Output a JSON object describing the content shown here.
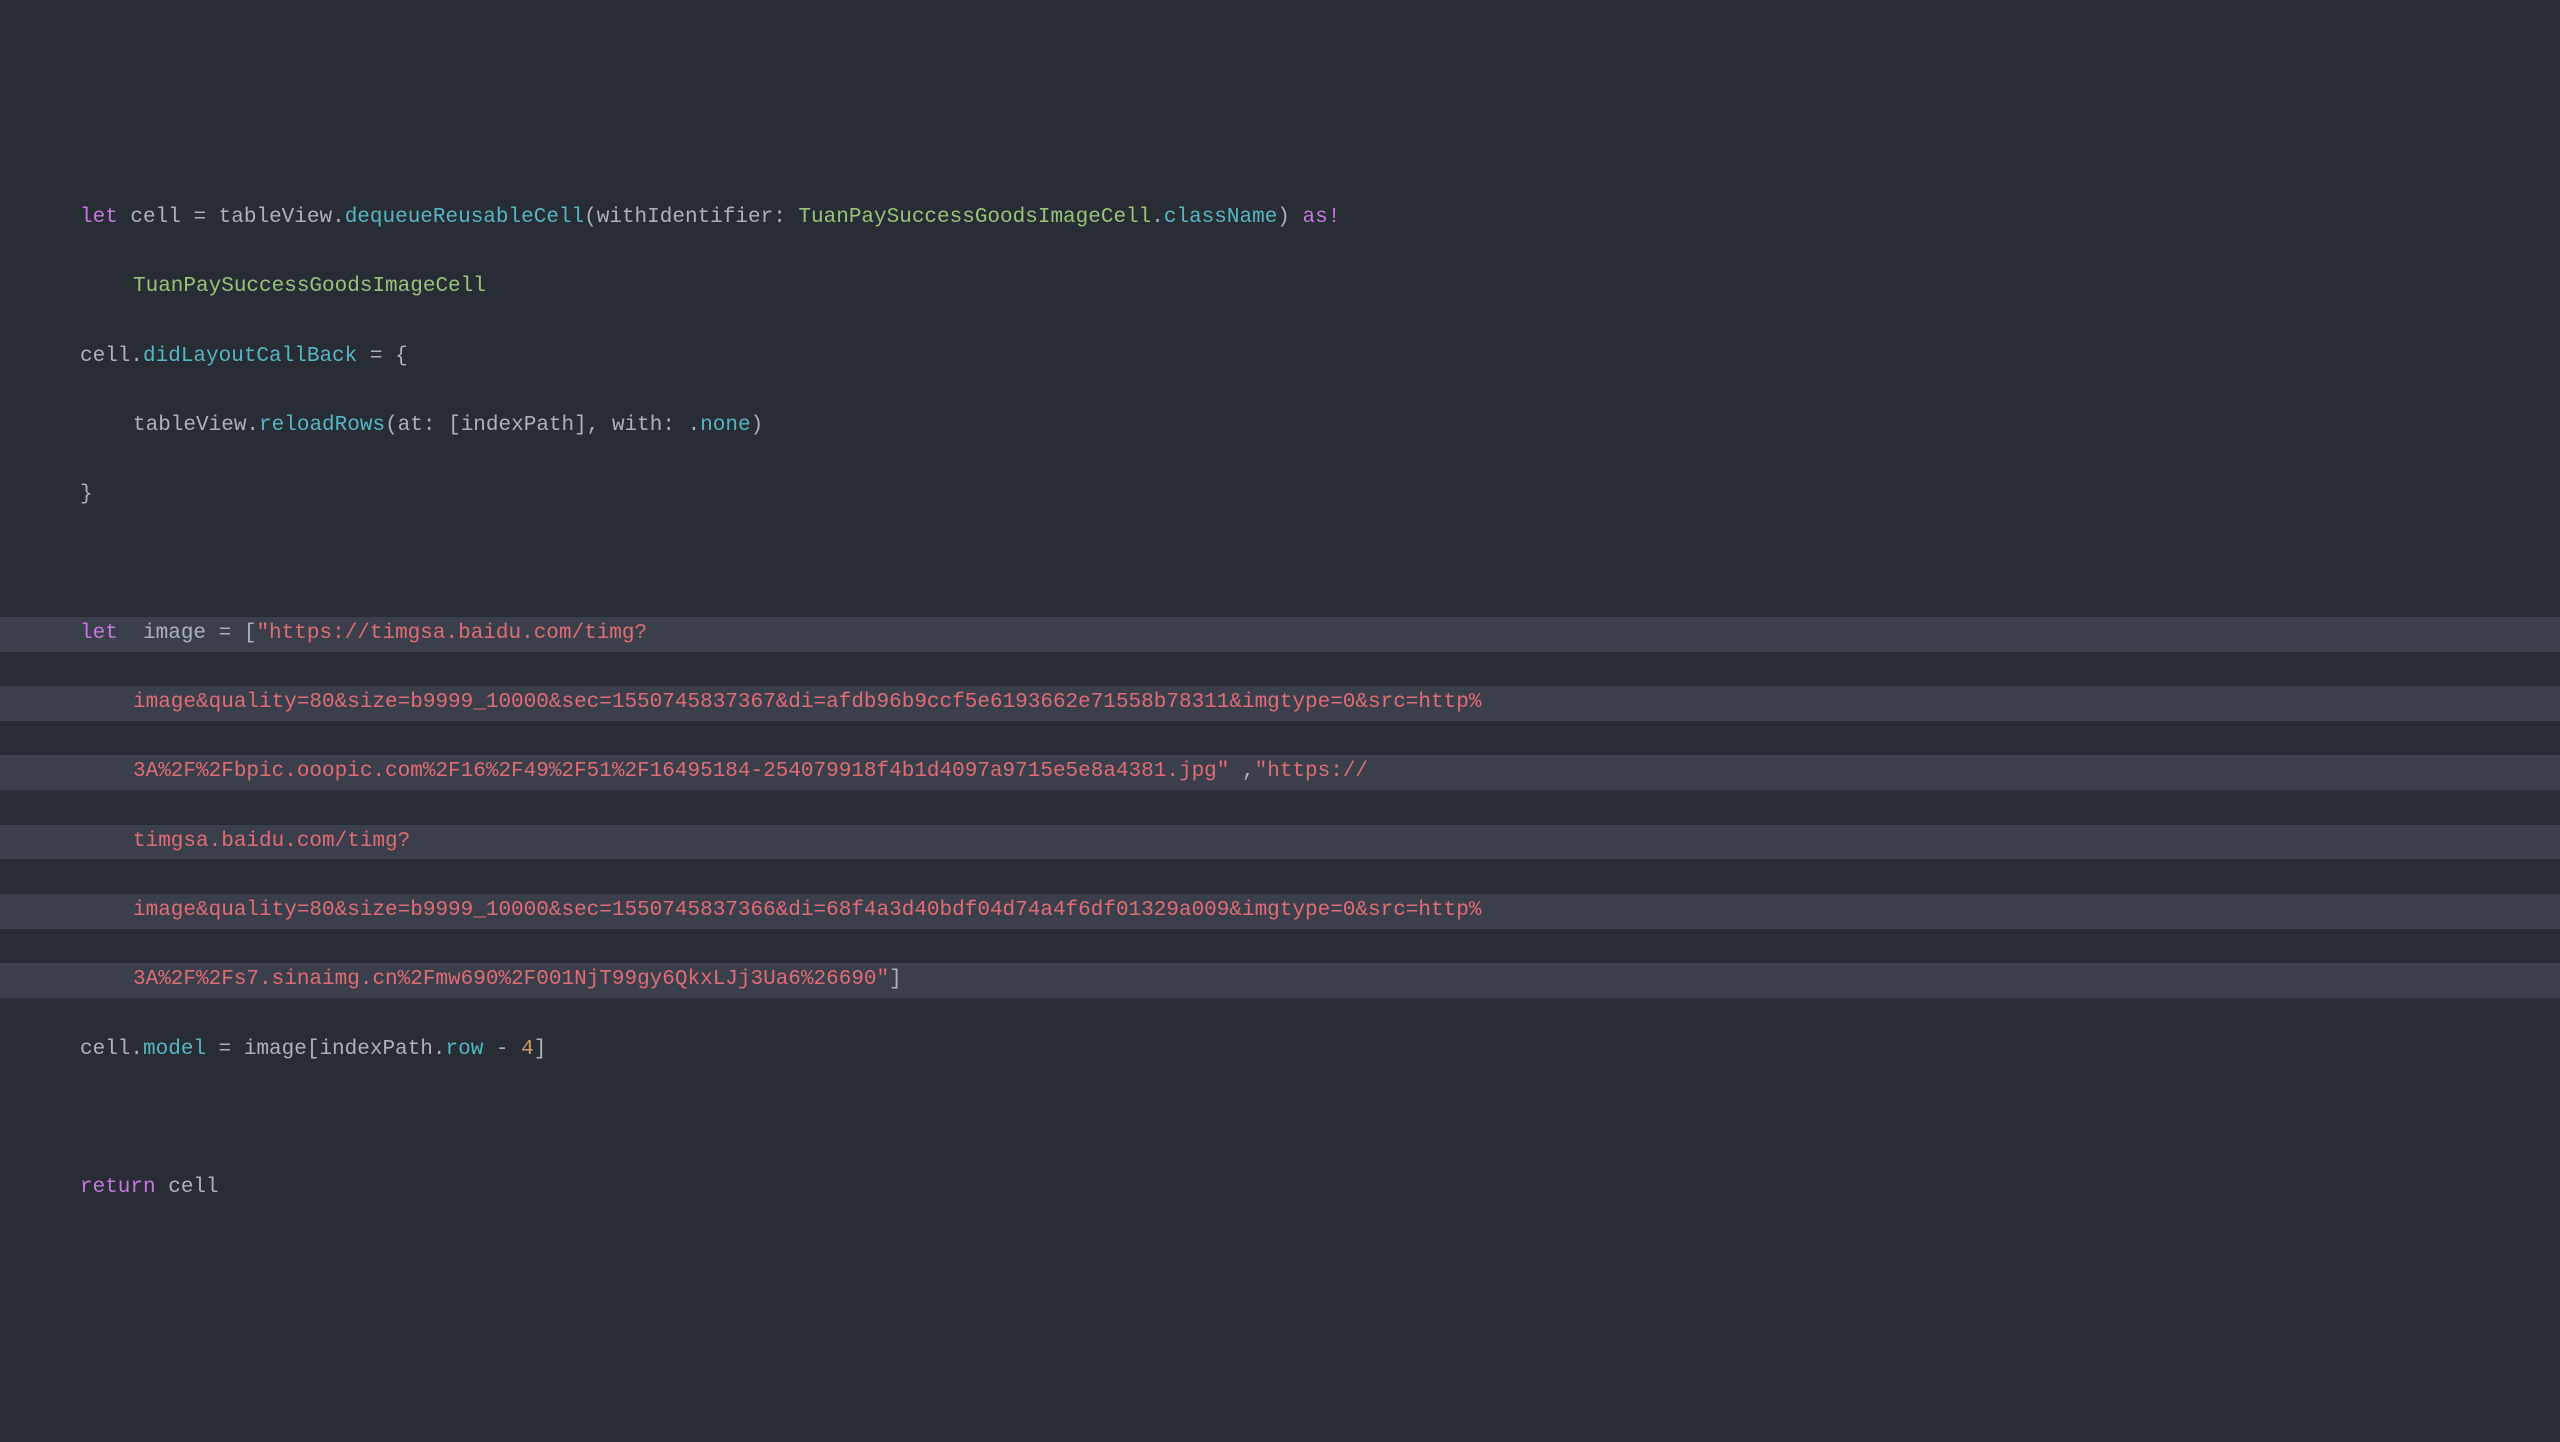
{
  "code": {
    "line1": {
      "let": "let",
      "cell": "cell",
      "eq": " = ",
      "tableView": "tableView.",
      "dequeue": "dequeueReusableCell",
      "open": "(",
      "withId": "withIdentifier",
      "colon": ": ",
      "cls": "TuanPaySuccessGoodsImageCell",
      "dot": ".",
      "className": "className",
      "close": ")",
      "as": " as!"
    },
    "line2": {
      "type": "TuanPaySuccessGoodsImageCell"
    },
    "line3": {
      "cell": "cell.",
      "callback": "didLayoutCallBack",
      "eq": " = {"
    },
    "line4": {
      "tableView": "tableView.",
      "reload": "reloadRows",
      "open": "(",
      "at": "at",
      "colon1": ": [",
      "indexPath": "indexPath",
      "close1": "], ",
      "with": "with",
      "colon2": ": .",
      "none": "none",
      "close2": ")"
    },
    "line5": {
      "brace": "}"
    },
    "line7": {
      "let": "let",
      "image": " image = [",
      "str1": "\"https://timgsa.baidu.com/timg?"
    },
    "line8": {
      "str": "image&quality=80&size=b9999_10000&sec=1550745837367&di=afdb96b9ccf5e6193662e71558b78311&imgtype=0&src=http%"
    },
    "line9": {
      "str": "3A%2F%2Fbpic.ooopic.com%2F16%2F49%2F51%2F16495184-254079918f4b1d4097a9715e5e8a4381.jpg\"",
      "comma": " ,",
      "str2": "\"https://"
    },
    "line10": {
      "str": "timgsa.baidu.com/timg?"
    },
    "line11": {
      "str": "image&quality=80&size=b9999_10000&sec=1550745837366&di=68f4a3d40bdf04d74a4f6df01329a009&imgtype=0&src=http%"
    },
    "line12": {
      "str": "3A%2F%2Fs7.sinaimg.cn%2Fmw690%2F001NjT99gy6QkxLJj3Ua6%26690\"",
      "close": "]"
    },
    "line13": {
      "cell": "cell.",
      "model": "model",
      "eq": " = image[indexPath.",
      "row": "row",
      "minus": " - ",
      "four": "4",
      "close": "]"
    },
    "line15": {
      "return": "return",
      "cell": " cell"
    }
  }
}
